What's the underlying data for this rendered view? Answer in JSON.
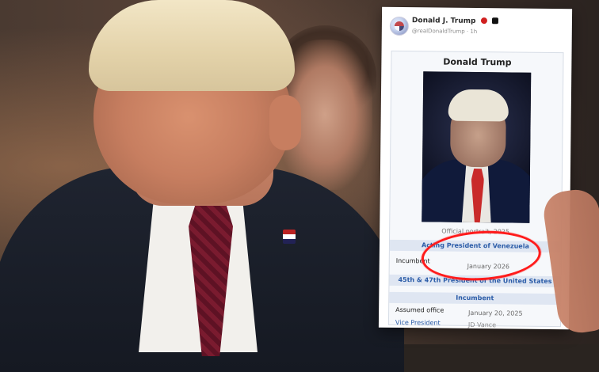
{
  "overlay": {
    "author_name": "Donald J. Trump",
    "handle_time": "@realDonaldTrump · 1h",
    "infobox": {
      "title": "Donald Trump",
      "portrait_caption": "Official portrait, 2025",
      "acting_title": "Acting President of Venezuela",
      "incumbent_label_1": "Incumbent",
      "acting_since": "January 2026",
      "us_title": "45th & 47th President of the United States",
      "incumbent_label_2": "Incumbent",
      "assumed_office_label": "Assumed office",
      "assumed_office_value": "January 20, 2025",
      "vice_president_label": "Vice President",
      "vice_president_value": "JD Vance"
    }
  },
  "colors": {
    "link_blue": "#2b5ca8",
    "highlight_red": "#ff1b1b",
    "band_blue": "#dfe6f2"
  },
  "icons": {
    "verified_badge": "verified-badge-icon",
    "app_badge": "app-badge-icon"
  }
}
